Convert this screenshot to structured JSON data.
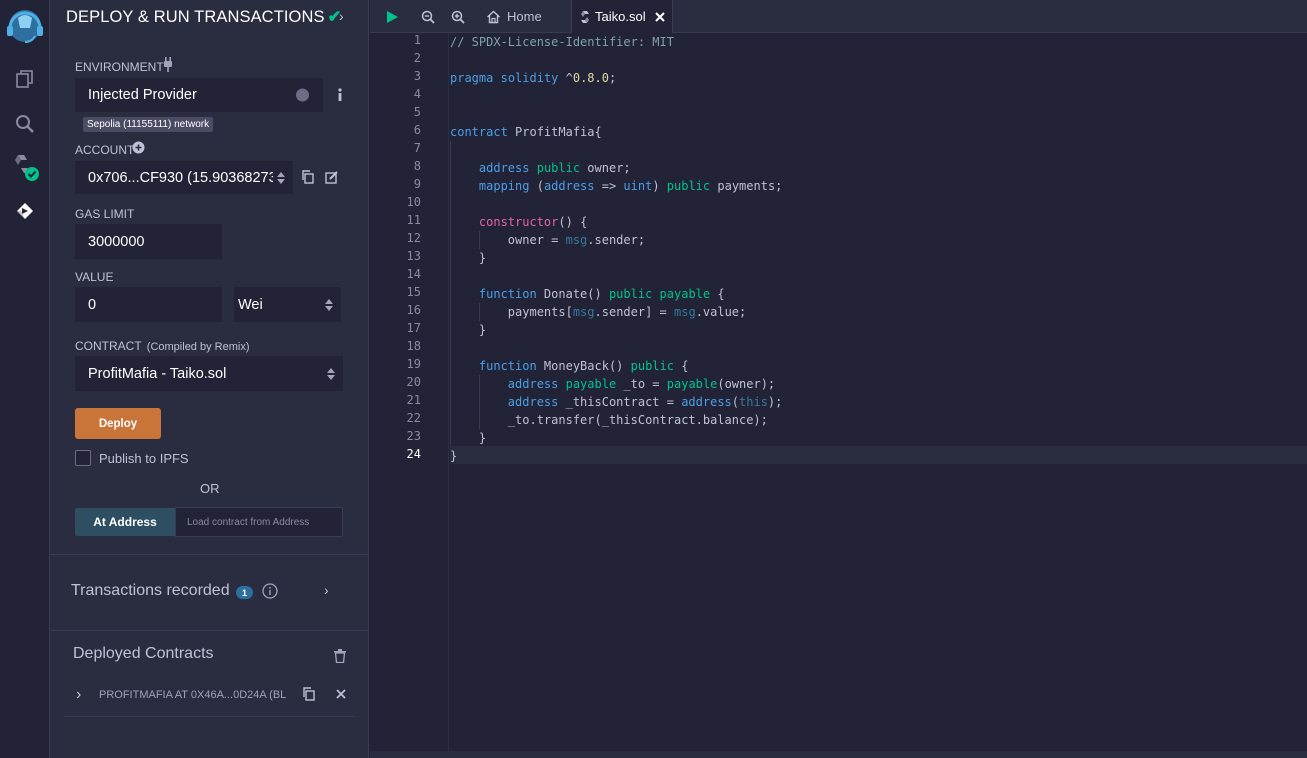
{
  "sidepanel": {
    "title": "DEPLOY & RUN TRANSACTIONS",
    "environment": {
      "label": "ENVIRONMENT",
      "value": "Injected Provider",
      "network_tooltip": "Sepolia (11155111) network"
    },
    "account": {
      "label": "ACCOUNT",
      "value": "0x706...CF930 (15.90368273"
    },
    "gas_limit": {
      "label": "GAS LIMIT",
      "value": "3000000"
    },
    "value": {
      "label": "VALUE",
      "amount": "0",
      "unit": "Wei"
    },
    "contract": {
      "label": "CONTRACT",
      "sublabel": "(Compiled by Remix)",
      "value": "ProfitMafia - Taiko.sol"
    },
    "deploy_label": "Deploy",
    "publish_label": "Publish to IPFS",
    "or_label": "OR",
    "at_address_label": "At Address",
    "at_address_placeholder": "Load contract from Address",
    "transactions": {
      "label": "Transactions recorded",
      "count": "1"
    },
    "deployed": {
      "label": "Deployed Contracts",
      "items": [
        "PROFITMAFIA AT 0X46A...0D24A (BL"
      ]
    }
  },
  "editor": {
    "tabs": [
      {
        "label": "Home"
      },
      {
        "label": "Taiko.sol"
      }
    ],
    "current_line": "24",
    "lines": [
      "1",
      "2",
      "3",
      "4",
      "5",
      "6",
      "7",
      "8",
      "9",
      "10",
      "11",
      "12",
      "13",
      "14",
      "15",
      "16",
      "17",
      "18",
      "19",
      "20",
      "21",
      "22",
      "23",
      "24"
    ]
  },
  "colors": {
    "accent_deploy": "#c97539",
    "success": "#00c28b",
    "panel_bg": "#2a2c3f",
    "editor_bg": "#222336"
  }
}
